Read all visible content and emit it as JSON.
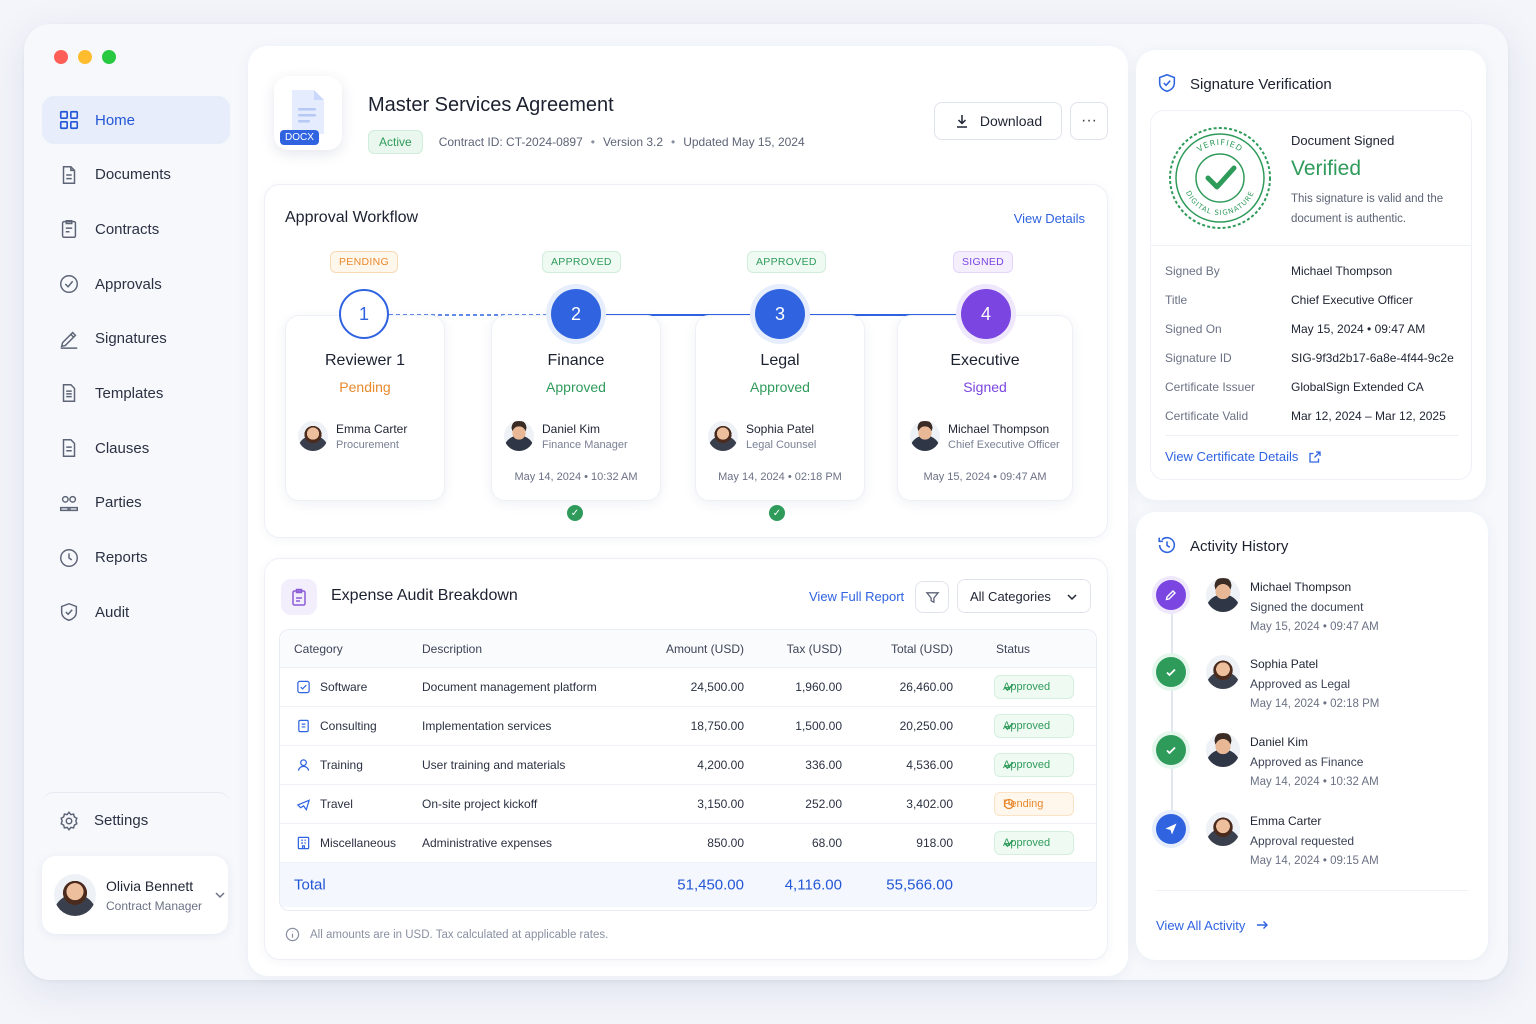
{
  "sidebar": {
    "items": [
      {
        "label": "Home",
        "icon": "grid-icon",
        "active": true
      },
      {
        "label": "Documents",
        "icon": "document-icon"
      },
      {
        "label": "Contracts",
        "icon": "contract-icon"
      },
      {
        "label": "Approvals",
        "icon": "check-circle-icon"
      },
      {
        "label": "Signatures",
        "icon": "pen-icon"
      },
      {
        "label": "Templates",
        "icon": "template-icon"
      },
      {
        "label": "Clauses",
        "icon": "clause-icon"
      },
      {
        "label": "Parties",
        "icon": "people-icon"
      },
      {
        "label": "Reports",
        "icon": "clock-icon"
      },
      {
        "label": "Audit",
        "icon": "shield-icon"
      }
    ],
    "settings_label": "Settings",
    "user": {
      "name": "Olivia Bennett",
      "role": "Contract Manager"
    }
  },
  "document": {
    "badge": "DOCX",
    "title": "Master Services Agreement",
    "status": "Active",
    "contract_id": "Contract ID: CT-2024-0897",
    "version": "Version 3.2",
    "updated": "Updated May 15, 2024",
    "download_label": "Download",
    "more_label": "···"
  },
  "workflow": {
    "title": "Approval Workflow",
    "link": "View Details",
    "stages": [
      {
        "num": "1",
        "badge": "PENDING",
        "name": "Reviewer 1",
        "status": "Pending",
        "person": "Emma Carter",
        "role": "Procurement",
        "date": ""
      },
      {
        "num": "2",
        "badge": "APPROVED",
        "name": "Finance",
        "status": "Approved",
        "person": "Daniel Kim",
        "role": "Finance Manager",
        "date": "May 14, 2024  •  10:32 AM"
      },
      {
        "num": "3",
        "badge": "APPROVED",
        "name": "Legal",
        "status": "Approved",
        "person": "Sophia Patel",
        "role": "Legal Counsel",
        "date": "May 14, 2024  •  02:18 PM"
      },
      {
        "num": "4",
        "badge": "SIGNED",
        "name": "Executive",
        "status": "Signed",
        "person": "Michael Thompson",
        "role": "Chief Executive Officer",
        "date": "May 15, 2024  •  09:47 AM"
      }
    ]
  },
  "expense": {
    "title": "Expense Audit Breakdown",
    "link": "View Full Report",
    "filter_value": "All Categories",
    "columns": [
      "Category",
      "Description",
      "Amount (USD)",
      "Tax (USD)",
      "Total (USD)",
      "Status"
    ],
    "rows": [
      {
        "category": "Software",
        "description": "Document management platform",
        "amount": "24,500.00",
        "tax": "1,960.00",
        "total": "26,460.00",
        "status": "Approved"
      },
      {
        "category": "Consulting",
        "description": "Implementation services",
        "amount": "18,750.00",
        "tax": "1,500.00",
        "total": "20,250.00",
        "status": "Approved"
      },
      {
        "category": "Training",
        "description": "User training and materials",
        "amount": "4,200.00",
        "tax": "336.00",
        "total": "4,536.00",
        "status": "Approved"
      },
      {
        "category": "Travel",
        "description": "On-site project kickoff",
        "amount": "3,150.00",
        "tax": "252.00",
        "total": "3,402.00",
        "status": "Pending"
      },
      {
        "category": "Miscellaneous",
        "description": "Administrative expenses",
        "amount": "850.00",
        "tax": "68.00",
        "total": "918.00",
        "status": "Approved"
      }
    ],
    "total": {
      "label": "Total",
      "amount": "51,450.00",
      "tax": "4,116.00",
      "total": "55,566.00"
    },
    "footnote": "All amounts are in USD. Tax calculated at applicable rates."
  },
  "signature": {
    "title": "Signature Verification",
    "seal_top": "VERIFIED",
    "seal_bottom": "DIGITAL SIGNATURE",
    "label": "Document Signed",
    "status": "Verified",
    "description": "This signature is valid and the document is authentic.",
    "fields": [
      {
        "key": "Signed By",
        "value": "Michael Thompson"
      },
      {
        "key": "Title",
        "value": "Chief Executive Officer"
      },
      {
        "key": "Signed On",
        "value": "May 15, 2024  •  09:47 AM"
      },
      {
        "key": "Signature ID",
        "value": "SIG-9f3d2b17-6a8e-4f44-9c2e"
      },
      {
        "key": "Certificate Issuer",
        "value": "GlobalSign Extended CA"
      },
      {
        "key": "Certificate Valid",
        "value": "Mar 12, 2024 – Mar 12, 2025"
      }
    ],
    "link": "View Certificate Details"
  },
  "activity": {
    "title": "Activity History",
    "items": [
      {
        "name": "Michael Thompson",
        "action": "Signed the document",
        "time": "May 15, 2024  •  09:47 AM",
        "kind": "signed"
      },
      {
        "name": "Sophia Patel",
        "action": "Approved as Legal",
        "time": "May 14, 2024  •  02:18 PM",
        "kind": "approved"
      },
      {
        "name": "Daniel Kim",
        "action": "Approved as Finance",
        "time": "May 14, 2024  •  10:32 AM",
        "kind": "approved"
      },
      {
        "name": "Emma Carter",
        "action": "Approval requested",
        "time": "May 14, 2024  •  09:15 AM",
        "kind": "requested"
      }
    ],
    "link": "View All Activity"
  },
  "colors": {
    "accent": "#2f63e0",
    "success": "#2f9b5b",
    "pending": "#e8892c",
    "signed": "#7a45e0"
  }
}
